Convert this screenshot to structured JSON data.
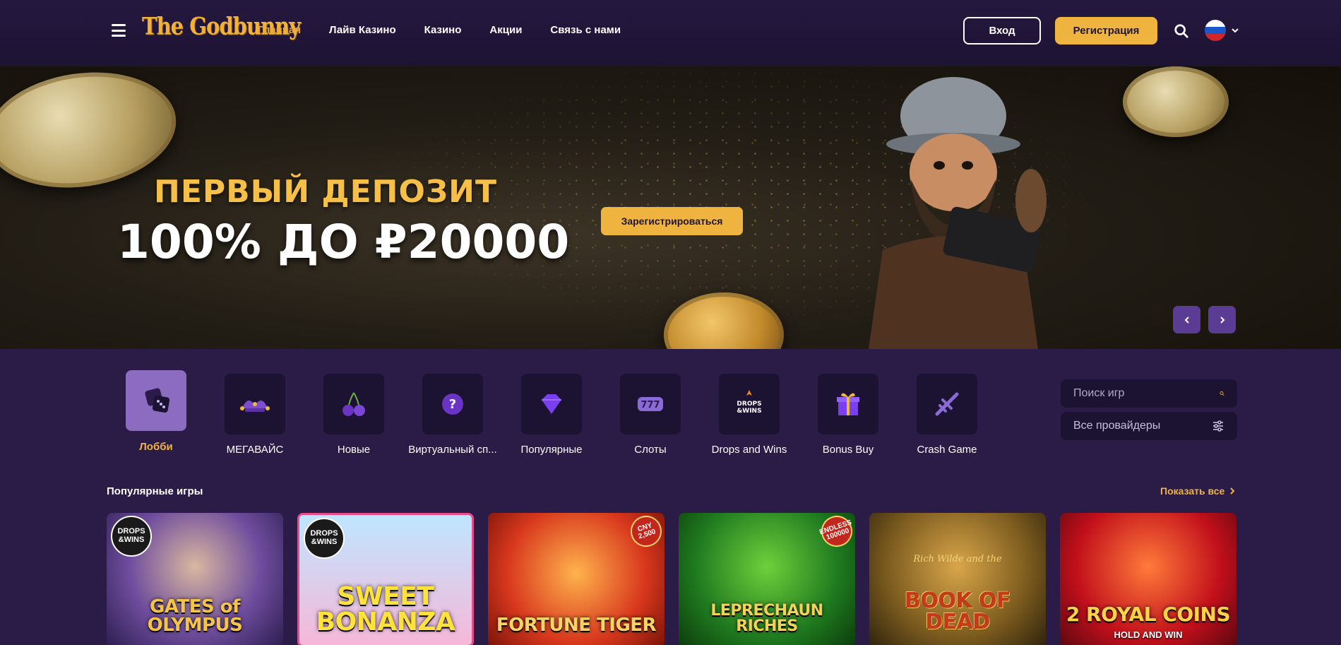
{
  "header": {
    "logo": "The Godbunny",
    "nav": [
      "Главная",
      "Лайв Казино",
      "Казино",
      "Акции",
      "Связь с нами"
    ],
    "active_nav": "Главная",
    "login_label": "Вход",
    "register_label": "Регистрация",
    "language": "ru"
  },
  "banner": {
    "line1": "ПЕРВЫЙ ДЕПОЗИТ",
    "line2": "100% ДО ₽20000",
    "cta": "Зарегистрироваться"
  },
  "categories": [
    {
      "label": "Лобби",
      "icon": "dice-icon",
      "active": true
    },
    {
      "label": "МЕГАВАЙС",
      "icon": "jester-hat-icon"
    },
    {
      "label": "Новые",
      "icon": "cherries-icon"
    },
    {
      "label": "Виртуальный сп...",
      "icon": "virtual-sport-ball-icon"
    },
    {
      "label": "Популярные",
      "icon": "diamond-icon"
    },
    {
      "label": "Слоты",
      "icon": "slot-777-icon"
    },
    {
      "label": "Drops and Wins",
      "icon": "drops-wins-icon"
    },
    {
      "label": "Bonus Buy",
      "icon": "gift-icon"
    },
    {
      "label": "Crash Game",
      "icon": "plane-icon"
    }
  ],
  "filters": {
    "search_placeholder": "Поиск игр",
    "providers_label": "Все провайдеры"
  },
  "popular": {
    "title": "Популярные игры",
    "show_all": "Показать все",
    "games": [
      {
        "title": "GATES of OLYMPUS",
        "badge": "DROPS &WINS"
      },
      {
        "title": "SWEET BONANZA",
        "badge": "DROPS &WINS"
      },
      {
        "title": "FORTUNE TIGER",
        "badge_corner": "CNY 2,500"
      },
      {
        "title": "LEPRECHAUN RICHES",
        "badge_corner": "ENDLESS 100000"
      },
      {
        "title": "BOOK OF DEAD",
        "subtitle": "Rich Wilde and the"
      },
      {
        "title": "2 ROYAL COINS",
        "subtitle": "HOLD AND WIN"
      }
    ]
  },
  "colors": {
    "accent": "#efb440",
    "background": "#2a1b47",
    "header": "#1d1333",
    "tile": "#1c1231",
    "active_tile": "#8b6cc1"
  }
}
